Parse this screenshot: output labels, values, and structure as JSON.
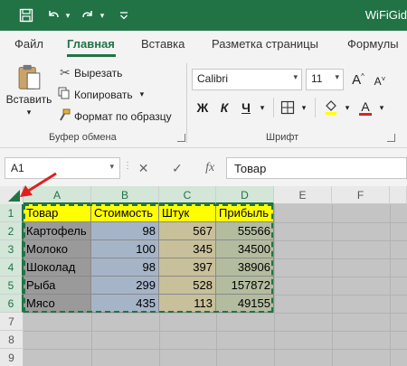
{
  "window": {
    "title": "WiFiGid"
  },
  "colors": {
    "excel_green": "#217346",
    "header_yellow": "#ffff00",
    "col_b_fill": "#a6b4c8",
    "col_c_fill": "#c8c09a",
    "col_d_fill": "#b4bca0",
    "col_a_fill": "#9a9a9a",
    "arrow_red": "#e02020"
  },
  "tabs": [
    {
      "label": "Файл",
      "active": false
    },
    {
      "label": "Главная",
      "active": true
    },
    {
      "label": "Вставка",
      "active": false
    },
    {
      "label": "Разметка страницы",
      "active": false
    },
    {
      "label": "Формулы",
      "active": false
    }
  ],
  "clipboard": {
    "paste": "Вставить",
    "cut": "Вырезать",
    "copy": "Копировать",
    "format_painter": "Формат по образцу",
    "group_label": "Буфер обмена"
  },
  "font": {
    "name": "Calibri",
    "size": "11",
    "bold": "Ж",
    "italic": "К",
    "underline": "Ч",
    "group_label": "Шрифт"
  },
  "formula_bar": {
    "name_box": "A1",
    "fx": "fx",
    "value": "Товар"
  },
  "columns": [
    "A",
    "B",
    "C",
    "D",
    "E",
    "F"
  ],
  "rows": [
    "1",
    "2",
    "3",
    "4",
    "5",
    "6",
    "7",
    "8",
    "9"
  ],
  "table": {
    "headers": [
      "Товар",
      "Стоимость",
      "Штук",
      "Прибыль"
    ],
    "data": [
      [
        "Картофель",
        "98",
        "567",
        "55566"
      ],
      [
        "Молоко",
        "100",
        "345",
        "34500"
      ],
      [
        "Шоколад",
        "98",
        "397",
        "38906"
      ],
      [
        "Рыба",
        "299",
        "528",
        "157872"
      ],
      [
        "Мясо",
        "435",
        "113",
        "49155"
      ]
    ]
  }
}
